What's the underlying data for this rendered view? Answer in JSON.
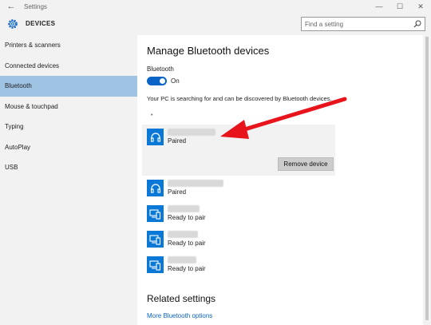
{
  "titlebar": {
    "back_icon": "back-arrow-icon",
    "title": "Settings",
    "minimize": "—",
    "maximize": "☐",
    "close": "✕"
  },
  "header": {
    "app_title": "DEVICES",
    "search_placeholder": "Find a setting"
  },
  "sidebar": {
    "items": [
      {
        "label": "Printers & scanners",
        "active": false
      },
      {
        "label": "Connected devices",
        "active": false
      },
      {
        "label": "Bluetooth",
        "active": true
      },
      {
        "label": "Mouse & touchpad",
        "active": false
      },
      {
        "label": "Typing",
        "active": false
      },
      {
        "label": "AutoPlay",
        "active": false
      },
      {
        "label": "USB",
        "active": false
      }
    ]
  },
  "main": {
    "heading": "Manage Bluetooth devices",
    "bluetooth_label": "Bluetooth",
    "toggle_state": "On",
    "description": "Your PC is searching for and can be discovered by Bluetooth devices.",
    "devices": [
      {
        "icon": "headphones-icon",
        "status": "Paired",
        "selected": true
      },
      {
        "icon": "headphones-icon",
        "status": "Paired",
        "selected": false
      },
      {
        "icon": "computer-phone-icon",
        "status": "Ready to pair",
        "selected": false
      },
      {
        "icon": "computer-phone-icon",
        "status": "Ready to pair",
        "selected": false
      },
      {
        "icon": "computer-phone-icon",
        "status": "Ready to pair",
        "selected": false
      }
    ],
    "remove_button": "Remove device",
    "related_heading": "Related settings",
    "related_link": "More Bluetooth options"
  },
  "colors": {
    "accent": "#0a64c8",
    "sidebar_active": "#9fc3e3",
    "annotation_arrow": "#e8141c"
  }
}
